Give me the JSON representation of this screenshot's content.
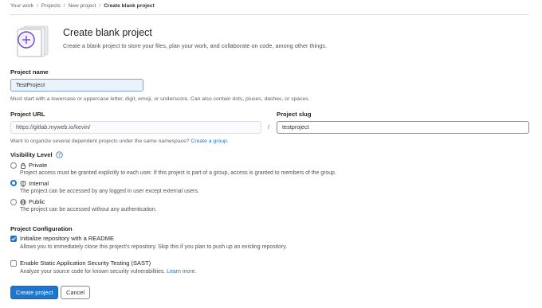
{
  "breadcrumb": {
    "items": [
      "Your work",
      "Projects",
      "New project",
      "Create blank project"
    ]
  },
  "header": {
    "title": "Create blank project",
    "description": "Create a blank project to store your files, plan your work, and collaborate on code, among other things."
  },
  "project_name": {
    "label": "Project name",
    "value": "TestProject",
    "help": "Must start with a lowercase or uppercase letter, digit, emoji, or underscore. Can also contain dots, pluses, dashes, or spaces."
  },
  "project_url": {
    "label": "Project URL",
    "value": "https://gitlab.myweb.io/kevin/",
    "separator": "/",
    "help_prefix": "Want to organize several dependent projects under the same namespace?",
    "help_link": "Create a group."
  },
  "project_slug": {
    "label": "Project slug",
    "value": "testproject"
  },
  "visibility": {
    "label": "Visibility Level",
    "selected": "Internal",
    "options": [
      {
        "label": "Private",
        "icon": "lock-icon",
        "description": "Project access must be granted explicitly to each user. If this project is part of a group, access is granted to members of the group."
      },
      {
        "label": "Internal",
        "icon": "shield-icon",
        "description": "The project can be accessed by any logged in user except external users."
      },
      {
        "label": "Public",
        "icon": "globe-icon",
        "description": "The project can be accessed without any authentication."
      }
    ]
  },
  "configuration": {
    "label": "Project Configuration",
    "options": [
      {
        "label": "Initialize repository with a README",
        "checked": true,
        "description": "Allows you to immediately clone this project’s repository. Skip this if you plan to push up an existing repository."
      },
      {
        "label": "Enable Static Application Security Testing (SAST)",
        "checked": false,
        "description": "Analyze your source code for known security vulnerabilities.",
        "link": "Learn more."
      }
    ]
  },
  "actions": {
    "create_label": "Create project",
    "cancel_label": "Cancel"
  },
  "colors": {
    "accent": "#1f75cb",
    "icon_purple": "#6e49cb"
  }
}
